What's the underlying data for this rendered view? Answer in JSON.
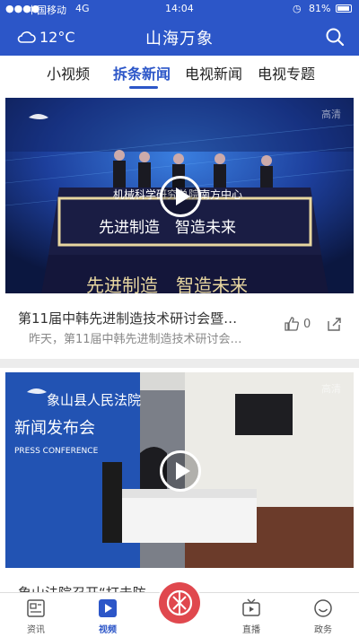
{
  "status_bar": {
    "carrier": "中国移动",
    "network": "4G",
    "time": "14:04",
    "battery": "81%"
  },
  "header": {
    "weather": "12°C",
    "title": "山海万象",
    "weather_icon": "cloud-icon",
    "search_icon": "search-icon"
  },
  "tabs": [
    {
      "label": "小视频",
      "active": false
    },
    {
      "label": "拆条新闻",
      "active": true
    },
    {
      "label": "电视新闻",
      "active": false
    },
    {
      "label": "电视专题",
      "active": false
    }
  ],
  "feed": [
    {
      "title": "第11届中韩先进制造技术研讨会暨…",
      "summary": "昨天，第11届中韩先进制造技术研讨会…",
      "likes": "0",
      "badge": "高清",
      "image_text": {
        "banner": "机械科学研究总院南方中心",
        "slogan": "先进制造　智造未来",
        "slogan_repeat": "先进制造　智造未来"
      }
    },
    {
      "title": "象山法院召开“打击防…",
      "summary": "",
      "likes": "",
      "badge": "高清",
      "image_text": {
        "court": "象山县人民法院",
        "event": "新闻发布会",
        "event_en": "PRESS CONFERENCE"
      }
    }
  ],
  "bottom_nav": [
    {
      "label": "资讯",
      "icon": "news-icon",
      "active": false
    },
    {
      "label": "视频",
      "icon": "video-play-icon",
      "active": true
    },
    {
      "label": "直播",
      "icon": "tv-icon",
      "active": false
    },
    {
      "label": "政务",
      "icon": "smile-icon",
      "active": false
    }
  ],
  "colors": {
    "brand": "#2c56c8",
    "center_button": "#e0484e"
  }
}
